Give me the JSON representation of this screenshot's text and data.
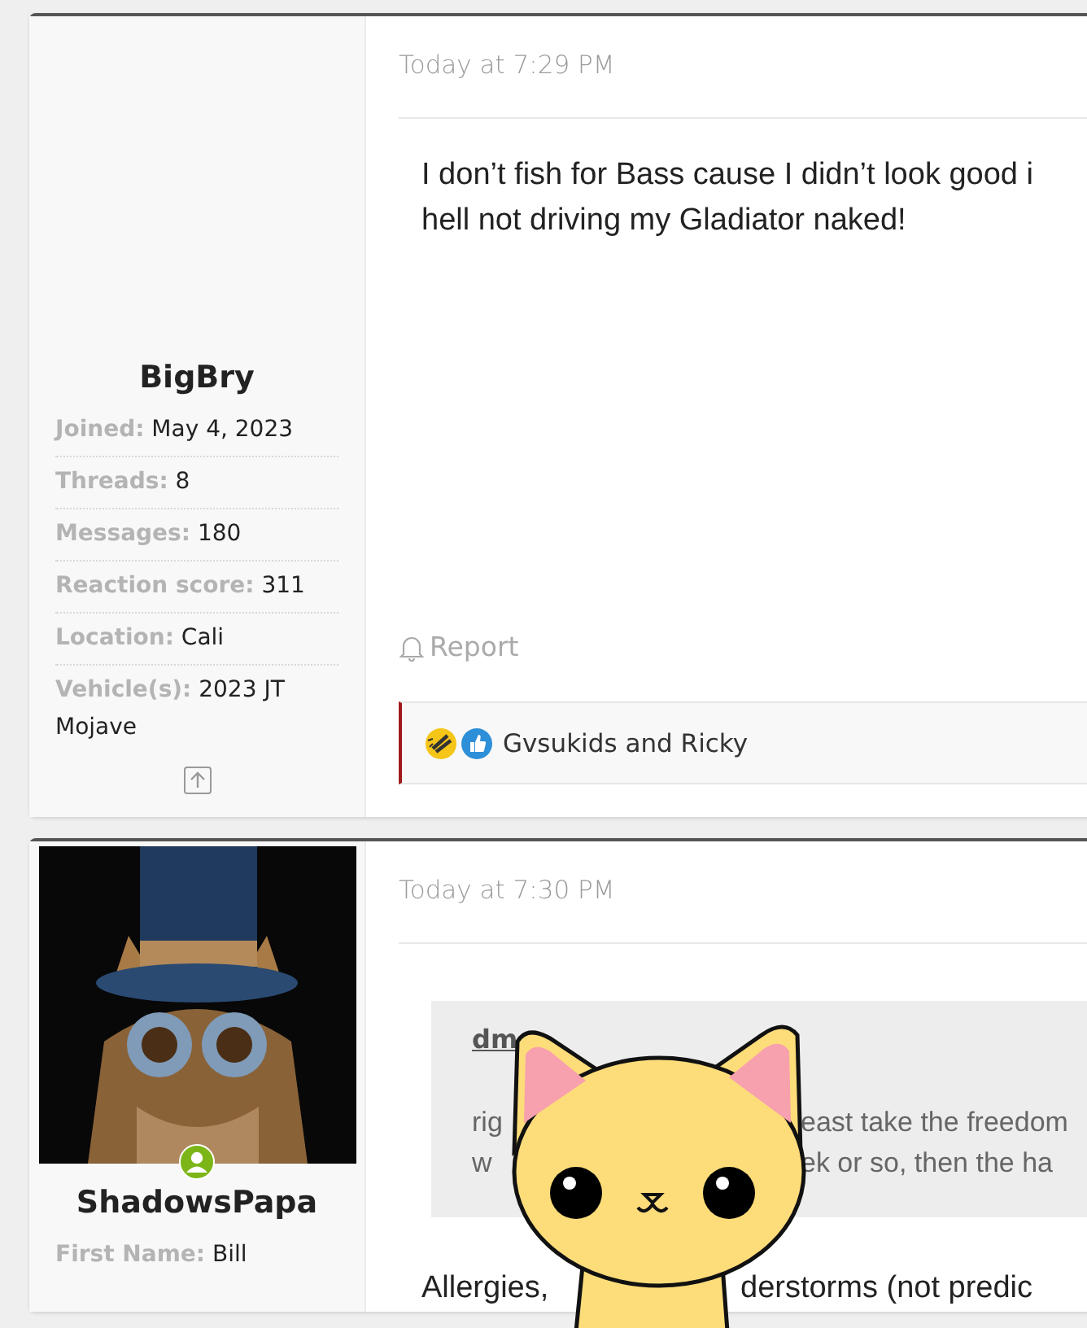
{
  "posts": [
    {
      "author": {
        "name": "BigBry",
        "stats": [
          {
            "label": "Joined:",
            "value": "May 4, 2023"
          },
          {
            "label": "Threads:",
            "value": "8"
          },
          {
            "label": "Messages:",
            "value": "180"
          },
          {
            "label": "Reaction score:",
            "value": "311"
          },
          {
            "label": "Location:",
            "value": "Cali"
          },
          {
            "label": "Vehicle(s):",
            "value": "2023 JT Mojave"
          }
        ],
        "top_link": true
      },
      "date": "Today at 7:29 PM",
      "body": [
        {
          "before": "I don’t fish for Bass cause I didn’t look good i"
        },
        {
          "before": "hell not driving my Gladiator naked!"
        }
      ],
      "actions": [
        "Report"
      ],
      "reactions": {
        "icons": [
          {
            "kind": "laugh"
          },
          {
            "kind": "like"
          }
        ],
        "text": "Gvsukids and Ricky"
      }
    },
    {
      "author": {
        "name": "ShadowsPapa",
        "avatar": {
          "kind": "picture",
          "online": true
        },
        "stats": [
          {
            "label": "First Name:",
            "value": "Bill"
          }
        ]
      },
      "date": "Today at 7:30 PM",
      "quote": {
        "author": "dm",
        "lines": [
          {
            "before": "rig",
            "after": "east take the freedom"
          },
          {
            "before": "w",
            "after": "ek or so, then the ha"
          }
        ]
      },
      "body": [
        {
          "before": "Allergies,",
          "after": "derstorms (not predic"
        }
      ]
    }
  ],
  "sticker": {
    "kind": "cat"
  }
}
